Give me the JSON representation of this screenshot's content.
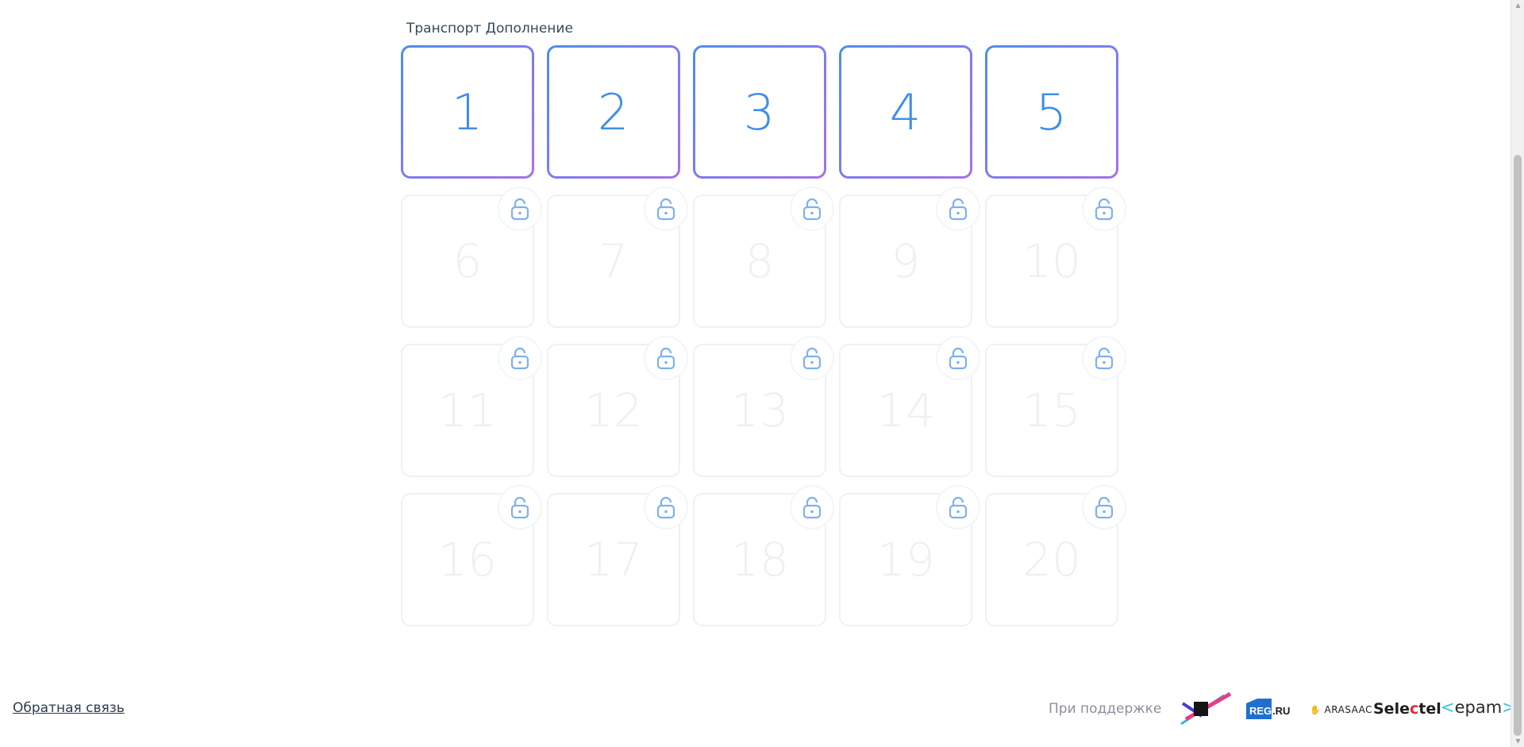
{
  "page": {
    "section_title": "Транспорт Дополнение"
  },
  "levels": [
    {
      "number": "1",
      "locked": false
    },
    {
      "number": "2",
      "locked": false
    },
    {
      "number": "3",
      "locked": false
    },
    {
      "number": "4",
      "locked": false
    },
    {
      "number": "5",
      "locked": false
    },
    {
      "number": "6",
      "locked": true
    },
    {
      "number": "7",
      "locked": true
    },
    {
      "number": "8",
      "locked": true
    },
    {
      "number": "9",
      "locked": true
    },
    {
      "number": "10",
      "locked": true
    },
    {
      "number": "11",
      "locked": true
    },
    {
      "number": "12",
      "locked": true
    },
    {
      "number": "13",
      "locked": true
    },
    {
      "number": "14",
      "locked": true
    },
    {
      "number": "15",
      "locked": true
    },
    {
      "number": "16",
      "locked": true
    },
    {
      "number": "17",
      "locked": true
    },
    {
      "number": "18",
      "locked": true
    },
    {
      "number": "19",
      "locked": true
    },
    {
      "number": "20",
      "locked": true
    }
  ],
  "footer": {
    "feedback_label": "Обратная связь",
    "support_label": "При поддержке",
    "sponsors": {
      "regru_reg": "REG",
      "regru_ru": ".RU",
      "arasaac": "ARASAAC",
      "selectel_pre": "Sele",
      "selectel_accent": "c",
      "selectel_post": "tel",
      "epam_open": "<",
      "epam_text": "epam",
      "epam_close": ">"
    }
  },
  "icons": {
    "lock": "lock-icon",
    "scroll_up": "scroll-up-arrow-icon",
    "scroll_down": "scroll-down-arrow-icon"
  },
  "colors": {
    "accent_blue": "#3f8ee9",
    "accent_purple": "#a571ea",
    "locked_number": "#eef0f3",
    "lock_icon": "#7fb0f0"
  }
}
